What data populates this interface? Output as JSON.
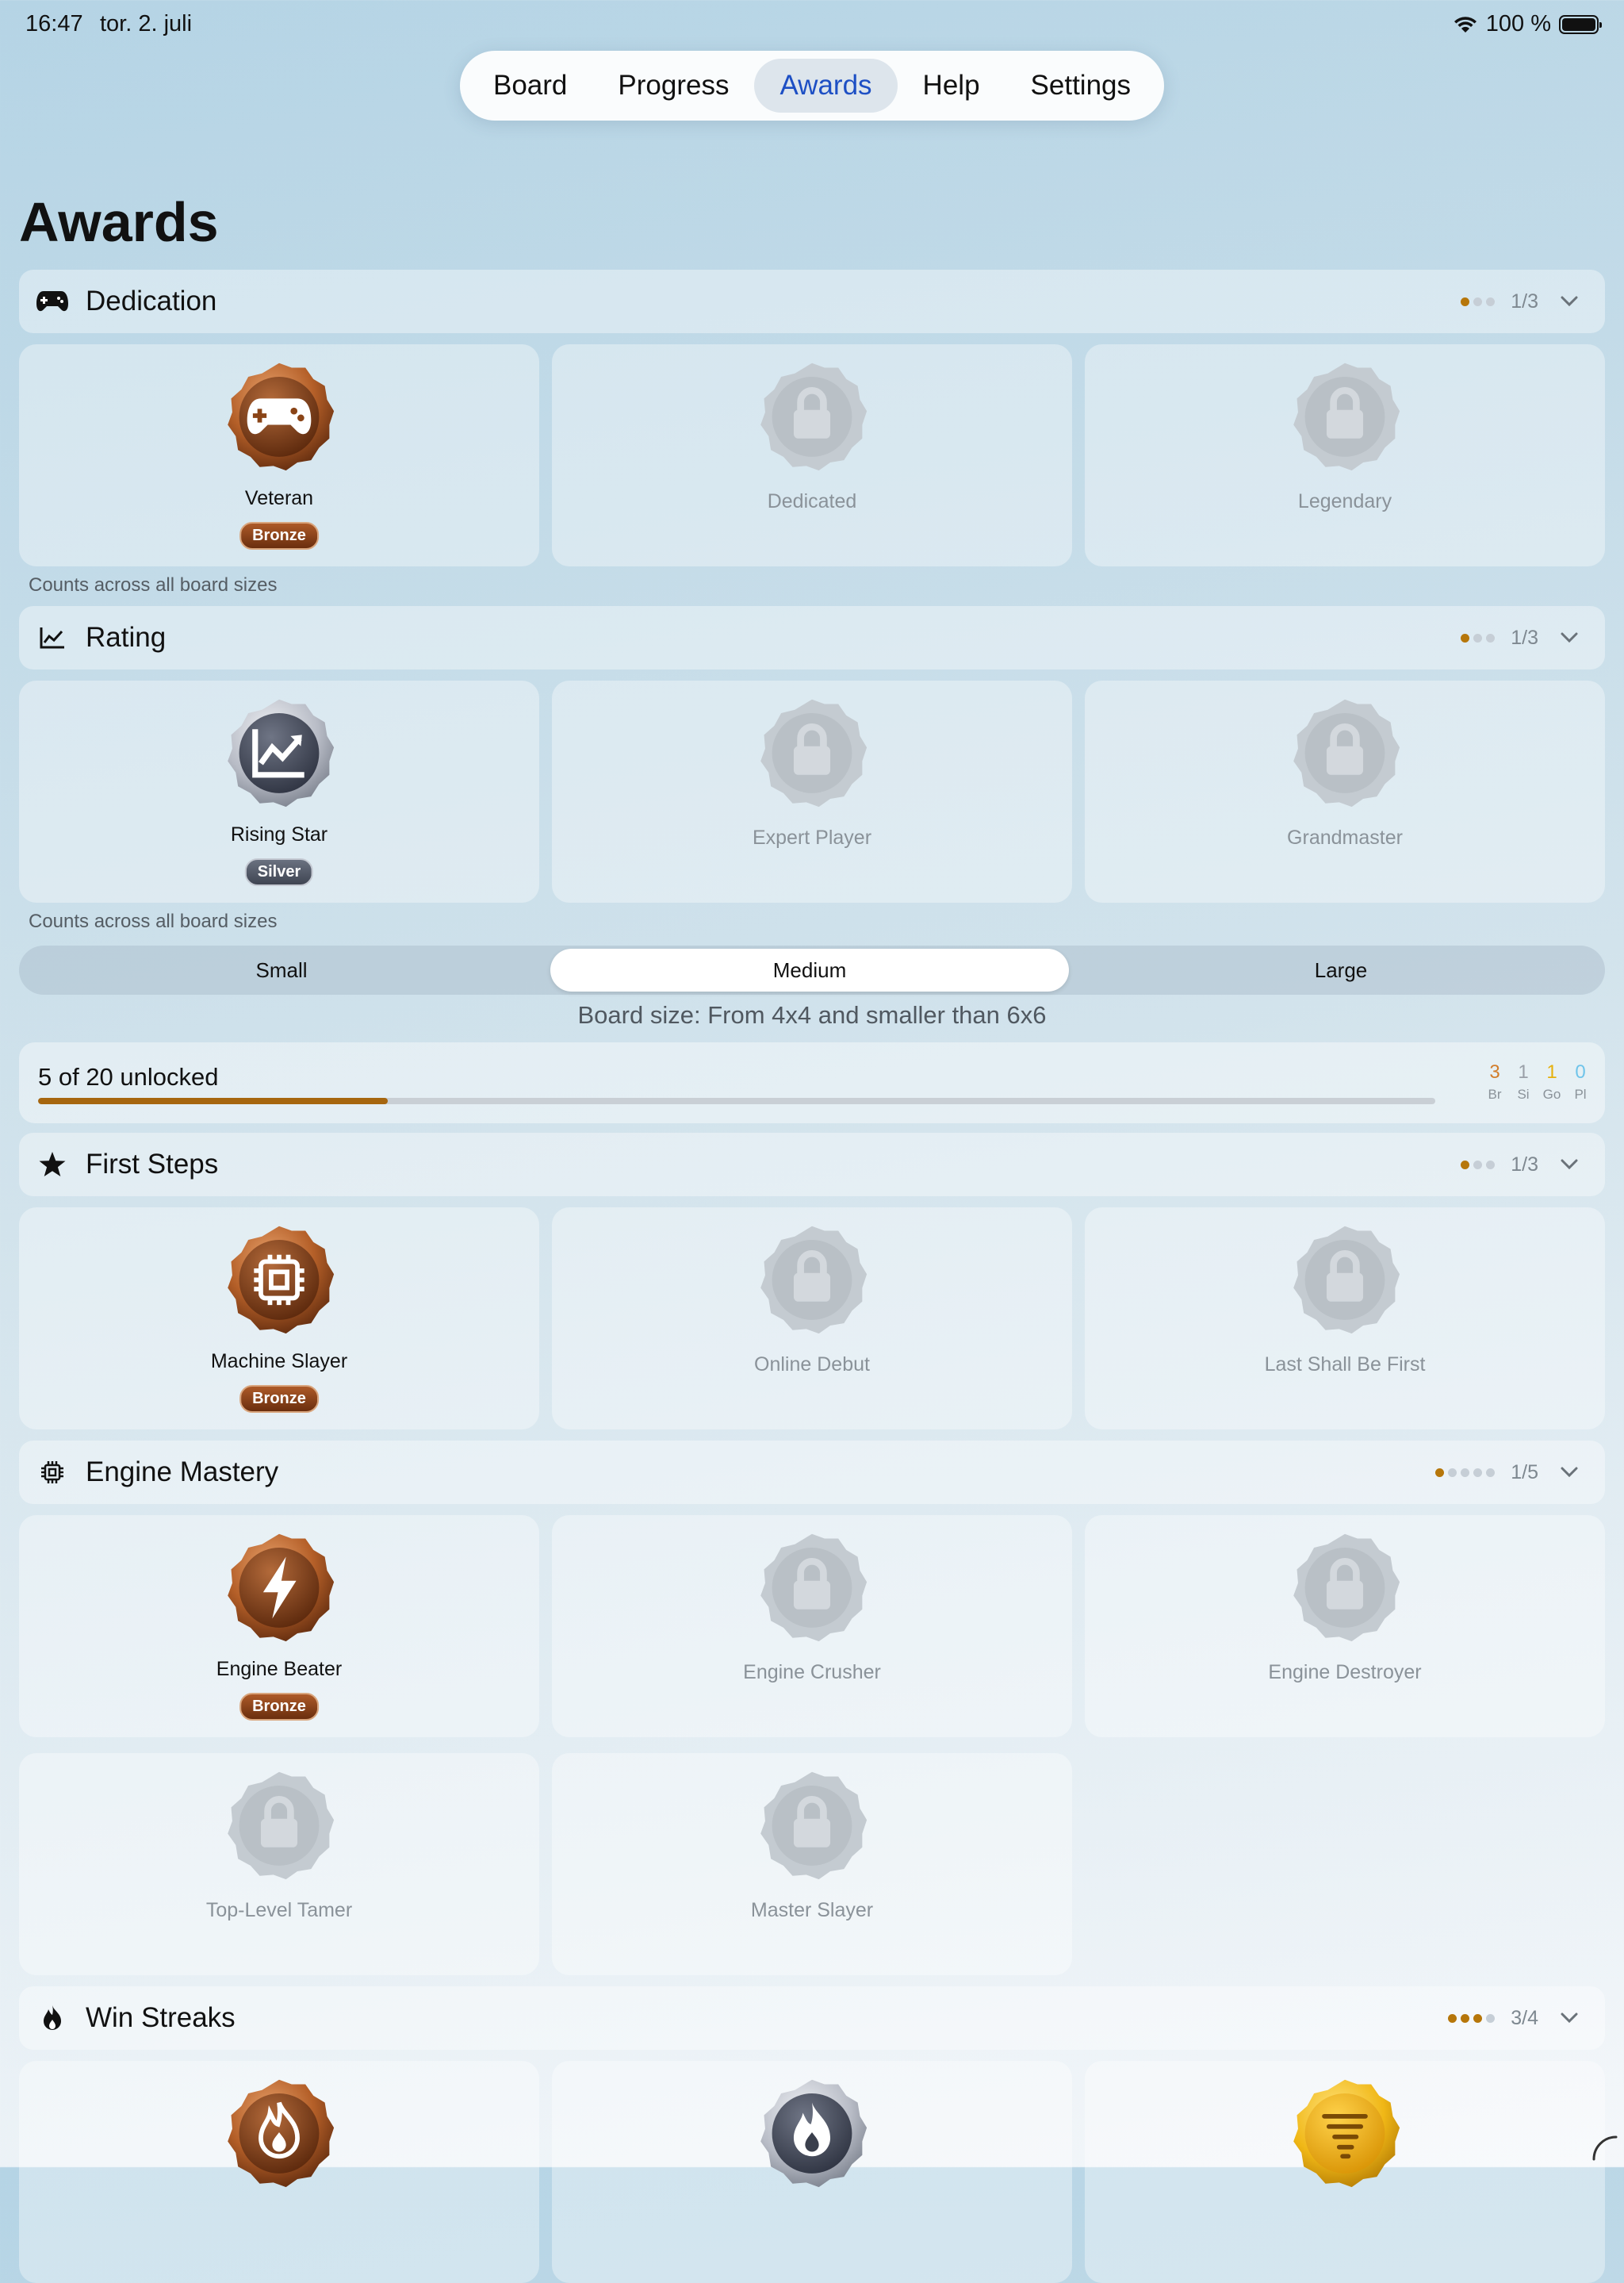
{
  "status": {
    "time": "16:47",
    "date": "tor. 2. juli",
    "battery": "100 %"
  },
  "nav": {
    "tabs": [
      {
        "label": "Board"
      },
      {
        "label": "Progress"
      },
      {
        "label": "Awards",
        "active": true
      },
      {
        "label": "Help"
      },
      {
        "label": "Settings"
      }
    ]
  },
  "page": {
    "title": "Awards"
  },
  "colors": {
    "accent": "#1d4fc4",
    "bronze": "#a6660f",
    "silver": "#8e939d",
    "gold": "#e8b20a",
    "platinum": "#7cc8ea"
  },
  "sections": {
    "dedication": {
      "title": "Dedication",
      "icon": "gamepad-icon",
      "count": "1/3",
      "dots_filled": 1,
      "dots_total": 3,
      "note": "Counts across all board sizes",
      "awards": [
        {
          "name": "Veteran",
          "tier": "Bronze",
          "icon": "gamepad-icon"
        },
        {
          "name": "Dedicated",
          "locked": true
        },
        {
          "name": "Legendary",
          "locked": true
        }
      ]
    },
    "rating": {
      "title": "Rating",
      "icon": "chart-icon",
      "count": "1/3",
      "dots_filled": 1,
      "dots_total": 3,
      "note": "Counts across all board sizes",
      "awards": [
        {
          "name": "Rising Star",
          "tier": "Silver",
          "icon": "chart-icon"
        },
        {
          "name": "Expert Player",
          "locked": true
        },
        {
          "name": "Grandmaster",
          "locked": true
        }
      ]
    },
    "first_steps": {
      "title": "First Steps",
      "icon": "star-icon",
      "count": "1/3",
      "dots_filled": 1,
      "dots_total": 3,
      "awards": [
        {
          "name": "Machine Slayer",
          "tier": "Bronze",
          "icon": "cpu-icon"
        },
        {
          "name": "Online Debut",
          "locked": true
        },
        {
          "name": "Last Shall Be First",
          "locked": true
        }
      ]
    },
    "engine_mastery": {
      "title": "Engine Mastery",
      "icon": "cpu-icon",
      "count": "1/5",
      "dots_filled": 1,
      "dots_total": 5,
      "awards": [
        {
          "name": "Engine Beater",
          "tier": "Bronze",
          "icon": "bolt-icon"
        },
        {
          "name": "Engine Crusher",
          "locked": true
        },
        {
          "name": "Engine Destroyer",
          "locked": true
        },
        {
          "name": "Top-Level Tamer",
          "locked": true
        },
        {
          "name": "Master Slayer",
          "locked": true
        }
      ]
    },
    "win_streaks": {
      "title": "Win Streaks",
      "icon": "flame-icon",
      "count": "3/4",
      "dots_filled": 3,
      "dots_total": 4,
      "awards": [
        {
          "icon": "flame-icon",
          "tier_color": "bronze"
        },
        {
          "icon": "flame-icon",
          "tier_color": "silver"
        },
        {
          "icon": "tornado-icon",
          "tier_color": "gold"
        }
      ]
    }
  },
  "board_sizes": {
    "options": [
      "Small",
      "Medium",
      "Large"
    ],
    "selected": "Medium",
    "description": "Board size: From 4x4 and smaller than 6x6"
  },
  "progress": {
    "label": "5 of 20 unlocked",
    "unlocked": 5,
    "total": 20,
    "tiers": [
      {
        "count": "3",
        "abbr": "Br",
        "color": "#d27d2a"
      },
      {
        "count": "1",
        "abbr": "Si",
        "color": "#9aa0a8"
      },
      {
        "count": "1",
        "abbr": "Go",
        "color": "#e6b10c"
      },
      {
        "count": "0",
        "abbr": "Pl",
        "color": "#6fc4ea"
      }
    ]
  }
}
